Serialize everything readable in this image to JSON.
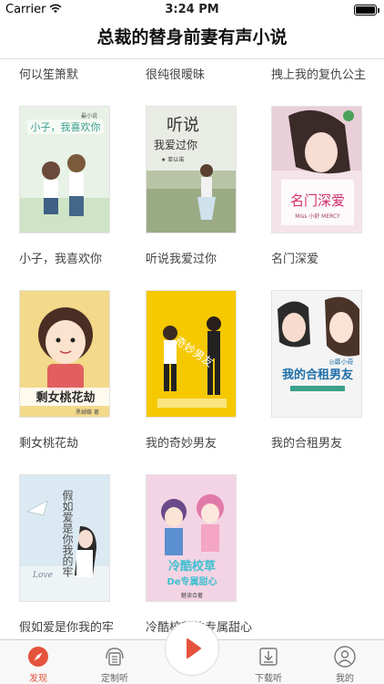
{
  "status_bar": {
    "carrier": "Carrier",
    "time": "3:24 PM"
  },
  "nav": {
    "title": "总裁的替身前妻有声小说"
  },
  "top_row": [
    "何以笙箫默",
    "很纯很暧昧",
    "拽上我的复仇公主"
  ],
  "books": [
    {
      "title": "小子，我喜欢你",
      "cover_text": "小子，我喜欢你",
      "cover_sub": "最小说"
    },
    {
      "title": "听说我爱过你",
      "cover_text": "听说",
      "cover_text2": "我爱过你",
      "cover_sub": "★ 亚以诺"
    },
    {
      "title": "名门深爱",
      "cover_text": "名门深爱",
      "cover_sub": "Miss 小舒 MERCY"
    },
    {
      "title": "剩女桃花劫",
      "cover_text": "剩女桃花劫",
      "cover_sub": "黑蝴蝶 著"
    },
    {
      "title": "我的奇妙男友",
      "cover_text": "奇妙男友",
      "cover_sub": ""
    },
    {
      "title": "我的合租男友",
      "cover_text": "我的合租男友",
      "cover_sub": "◎靡小奇"
    },
    {
      "title": "假如爱是你我的牢",
      "cover_text": "假如爱是你我的牢",
      "cover_sub": "Love"
    },
    {
      "title": "冷酷校草的专属甜心",
      "cover_text": "冷酷校草",
      "cover_text2": "De专属甜心",
      "cover_sub": "魅读合著"
    }
  ],
  "tabs": [
    {
      "label": "发现",
      "icon": "compass-icon",
      "active": true
    },
    {
      "label": "定制听",
      "icon": "headphones-book-icon",
      "active": false
    },
    {
      "label": "下载听",
      "icon": "download-icon",
      "active": false
    },
    {
      "label": "我的",
      "icon": "user-icon",
      "active": false
    }
  ],
  "colors": {
    "accent": "#e5533c",
    "tab_inactive": "#666666"
  }
}
